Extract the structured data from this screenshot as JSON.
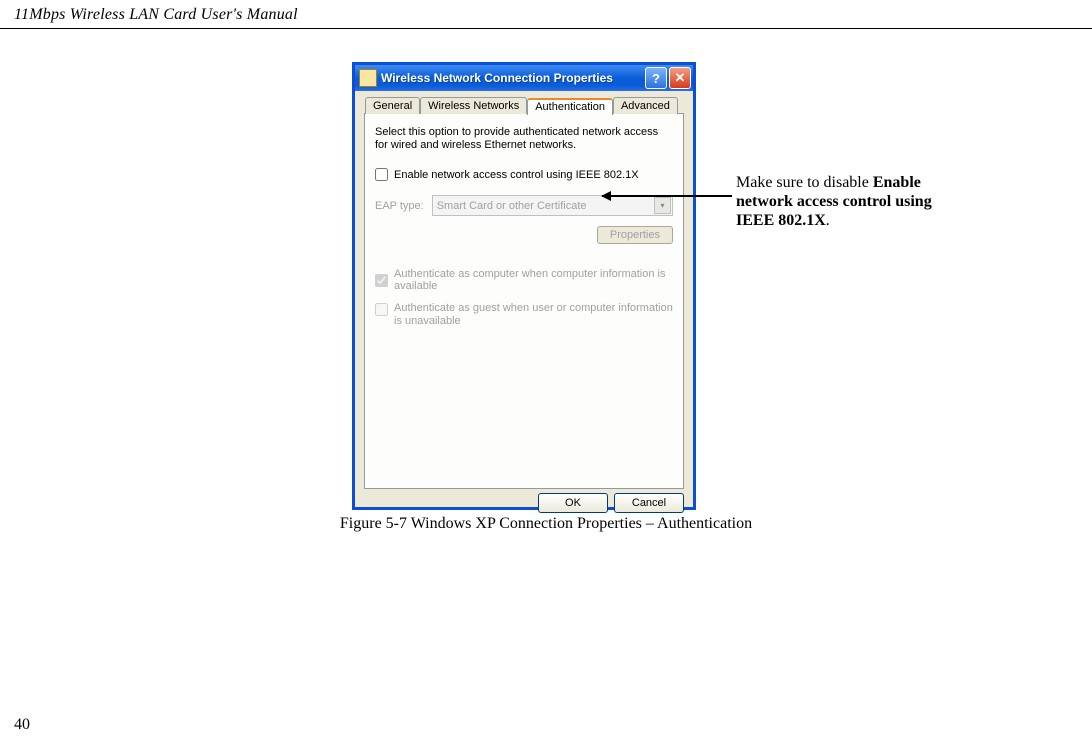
{
  "header": "11Mbps Wireless LAN Card User's Manual",
  "dialog": {
    "title": "Wireless Network Connection Properties",
    "help_symbol": "?",
    "close_symbol": "✕",
    "tabs": {
      "general": "General",
      "wireless": "Wireless Networks",
      "authentication": "Authentication",
      "advanced": "Advanced"
    },
    "desc": "Select this option to provide authenticated network access for wired and wireless Ethernet networks.",
    "enable_label": "Enable network access control using IEEE 802.1X",
    "eap_label": "EAP type:",
    "eap_value": "Smart Card or other Certificate",
    "properties_btn": "Properties",
    "auth_computer": "Authenticate as computer when computer information is available",
    "auth_guest": "Authenticate as guest when user or computer information is unavailable",
    "ok": "OK",
    "cancel": "Cancel"
  },
  "annotation": {
    "prefix": "Make sure to disable ",
    "bold": "Enable network access control using IEEE 802.1X",
    "suffix": "."
  },
  "caption": "Figure 5-7    Windows XP Connection Properties – Authentication",
  "page_number": "40"
}
